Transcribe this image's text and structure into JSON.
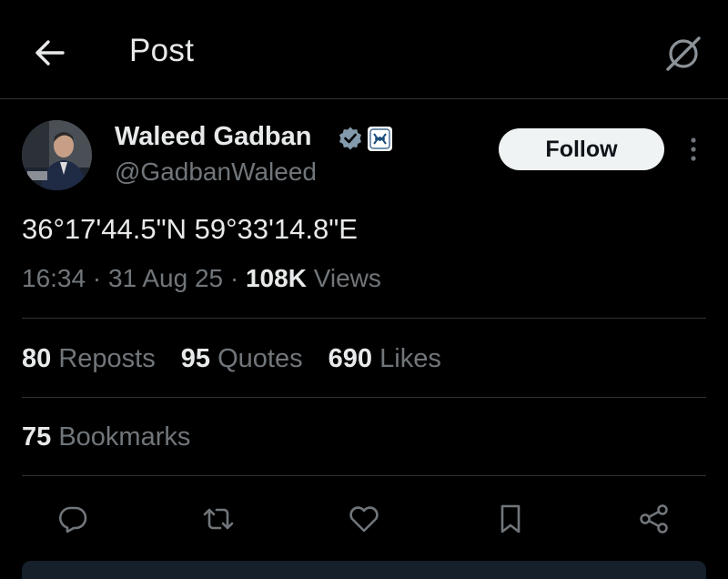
{
  "header": {
    "title": "Post",
    "back_icon": "arrow-left-icon",
    "grok_icon": "grok-icon"
  },
  "author": {
    "display_name": "Waleed Gadban",
    "handle": "@GadbanWaleed",
    "verified_icon": "verified-badge-icon",
    "affiliation_icon": "affiliation-badge-icon"
  },
  "actions_top": {
    "follow_label": "Follow",
    "more_icon": "more-vertical-icon"
  },
  "post": {
    "text": "36°17'44.5\"N 59°33'14.8\"E",
    "time": "16:34",
    "date": "31 Aug 25",
    "views_count": "108K",
    "views_label": "Views"
  },
  "stats": {
    "reposts_count": "80",
    "reposts_label": "Reposts",
    "quotes_count": "95",
    "quotes_label": "Quotes",
    "likes_count": "690",
    "likes_label": "Likes",
    "bookmarks_count": "75",
    "bookmarks_label": "Bookmarks"
  },
  "action_bar": [
    "reply-icon",
    "repost-icon",
    "like-icon",
    "bookmark-icon",
    "share-icon"
  ],
  "colors": {
    "background": "#000000",
    "text": "#e7e9ea",
    "muted": "#71767b",
    "divider": "#2f3336",
    "verified": "#829aab"
  }
}
